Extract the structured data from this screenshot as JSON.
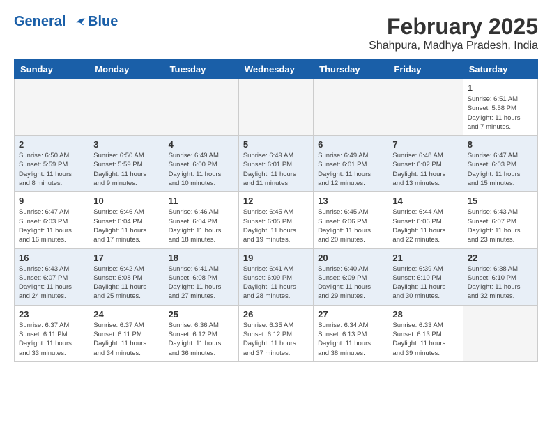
{
  "header": {
    "logo_line1": "General",
    "logo_line2": "Blue",
    "title": "February 2025",
    "subtitle": "Shahpura, Madhya Pradesh, India"
  },
  "weekdays": [
    "Sunday",
    "Monday",
    "Tuesday",
    "Wednesday",
    "Thursday",
    "Friday",
    "Saturday"
  ],
  "weeks": [
    [
      {
        "day": "",
        "info": ""
      },
      {
        "day": "",
        "info": ""
      },
      {
        "day": "",
        "info": ""
      },
      {
        "day": "",
        "info": ""
      },
      {
        "day": "",
        "info": ""
      },
      {
        "day": "",
        "info": ""
      },
      {
        "day": "1",
        "info": "Sunrise: 6:51 AM\nSunset: 5:58 PM\nDaylight: 11 hours\nand 7 minutes."
      }
    ],
    [
      {
        "day": "2",
        "info": "Sunrise: 6:50 AM\nSunset: 5:59 PM\nDaylight: 11 hours\nand 8 minutes."
      },
      {
        "day": "3",
        "info": "Sunrise: 6:50 AM\nSunset: 5:59 PM\nDaylight: 11 hours\nand 9 minutes."
      },
      {
        "day": "4",
        "info": "Sunrise: 6:49 AM\nSunset: 6:00 PM\nDaylight: 11 hours\nand 10 minutes."
      },
      {
        "day": "5",
        "info": "Sunrise: 6:49 AM\nSunset: 6:01 PM\nDaylight: 11 hours\nand 11 minutes."
      },
      {
        "day": "6",
        "info": "Sunrise: 6:49 AM\nSunset: 6:01 PM\nDaylight: 11 hours\nand 12 minutes."
      },
      {
        "day": "7",
        "info": "Sunrise: 6:48 AM\nSunset: 6:02 PM\nDaylight: 11 hours\nand 13 minutes."
      },
      {
        "day": "8",
        "info": "Sunrise: 6:47 AM\nSunset: 6:03 PM\nDaylight: 11 hours\nand 15 minutes."
      }
    ],
    [
      {
        "day": "9",
        "info": "Sunrise: 6:47 AM\nSunset: 6:03 PM\nDaylight: 11 hours\nand 16 minutes."
      },
      {
        "day": "10",
        "info": "Sunrise: 6:46 AM\nSunset: 6:04 PM\nDaylight: 11 hours\nand 17 minutes."
      },
      {
        "day": "11",
        "info": "Sunrise: 6:46 AM\nSunset: 6:04 PM\nDaylight: 11 hours\nand 18 minutes."
      },
      {
        "day": "12",
        "info": "Sunrise: 6:45 AM\nSunset: 6:05 PM\nDaylight: 11 hours\nand 19 minutes."
      },
      {
        "day": "13",
        "info": "Sunrise: 6:45 AM\nSunset: 6:06 PM\nDaylight: 11 hours\nand 20 minutes."
      },
      {
        "day": "14",
        "info": "Sunrise: 6:44 AM\nSunset: 6:06 PM\nDaylight: 11 hours\nand 22 minutes."
      },
      {
        "day": "15",
        "info": "Sunrise: 6:43 AM\nSunset: 6:07 PM\nDaylight: 11 hours\nand 23 minutes."
      }
    ],
    [
      {
        "day": "16",
        "info": "Sunrise: 6:43 AM\nSunset: 6:07 PM\nDaylight: 11 hours\nand 24 minutes."
      },
      {
        "day": "17",
        "info": "Sunrise: 6:42 AM\nSunset: 6:08 PM\nDaylight: 11 hours\nand 25 minutes."
      },
      {
        "day": "18",
        "info": "Sunrise: 6:41 AM\nSunset: 6:08 PM\nDaylight: 11 hours\nand 27 minutes."
      },
      {
        "day": "19",
        "info": "Sunrise: 6:41 AM\nSunset: 6:09 PM\nDaylight: 11 hours\nand 28 minutes."
      },
      {
        "day": "20",
        "info": "Sunrise: 6:40 AM\nSunset: 6:09 PM\nDaylight: 11 hours\nand 29 minutes."
      },
      {
        "day": "21",
        "info": "Sunrise: 6:39 AM\nSunset: 6:10 PM\nDaylight: 11 hours\nand 30 minutes."
      },
      {
        "day": "22",
        "info": "Sunrise: 6:38 AM\nSunset: 6:10 PM\nDaylight: 11 hours\nand 32 minutes."
      }
    ],
    [
      {
        "day": "23",
        "info": "Sunrise: 6:37 AM\nSunset: 6:11 PM\nDaylight: 11 hours\nand 33 minutes."
      },
      {
        "day": "24",
        "info": "Sunrise: 6:37 AM\nSunset: 6:11 PM\nDaylight: 11 hours\nand 34 minutes."
      },
      {
        "day": "25",
        "info": "Sunrise: 6:36 AM\nSunset: 6:12 PM\nDaylight: 11 hours\nand 36 minutes."
      },
      {
        "day": "26",
        "info": "Sunrise: 6:35 AM\nSunset: 6:12 PM\nDaylight: 11 hours\nand 37 minutes."
      },
      {
        "day": "27",
        "info": "Sunrise: 6:34 AM\nSunset: 6:13 PM\nDaylight: 11 hours\nand 38 minutes."
      },
      {
        "day": "28",
        "info": "Sunrise: 6:33 AM\nSunset: 6:13 PM\nDaylight: 11 hours\nand 39 minutes."
      },
      {
        "day": "",
        "info": ""
      }
    ]
  ]
}
